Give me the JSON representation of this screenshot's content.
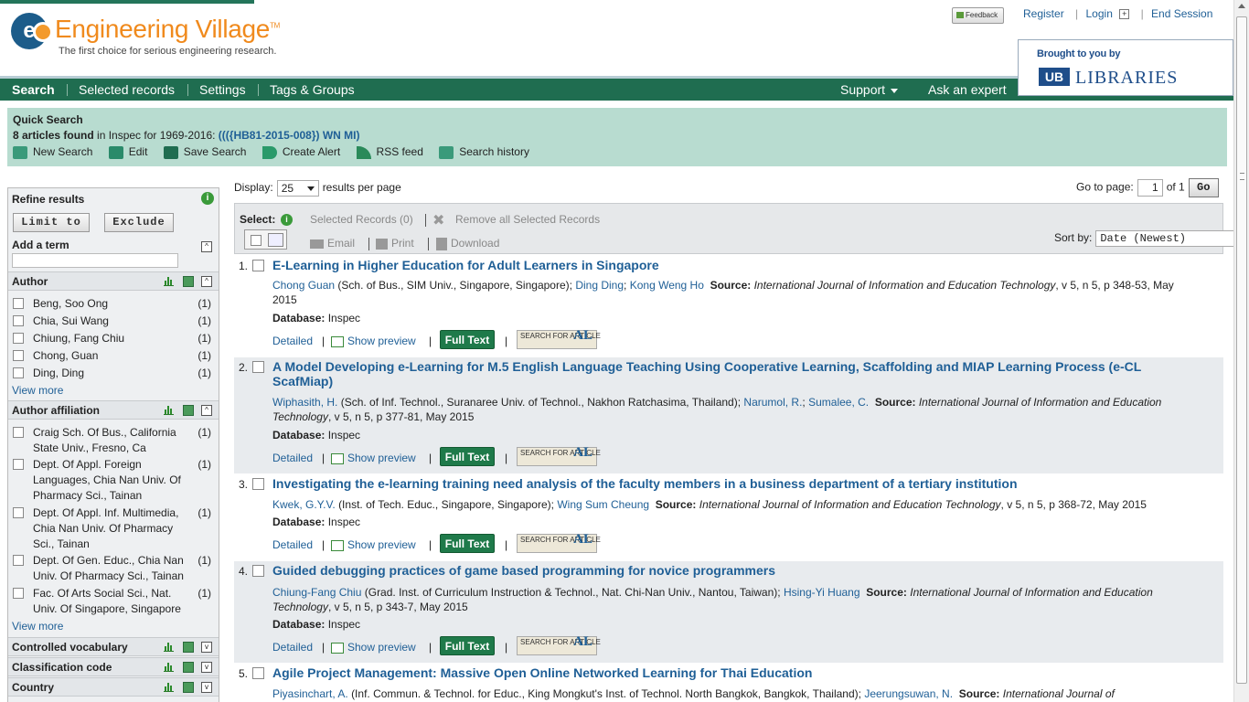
{
  "header": {
    "logo_text": "Engineering Village",
    "logo_tm": "TM",
    "tagline": "The first choice for serious engineering research.",
    "feedback_label": "Feedback",
    "links": {
      "register": "Register",
      "login": "Login",
      "end_session": "End Session"
    },
    "brought_to_you": "Brought to you by",
    "library_name": "LIBRARIES",
    "library_logo": "UB"
  },
  "nav": {
    "search": "Search",
    "selected_records": "Selected records",
    "settings": "Settings",
    "tags_groups": "Tags & Groups",
    "support": "Support",
    "ask_expert": "Ask an expert"
  },
  "quick_search": {
    "title": "Quick Search",
    "count": "8 articles found",
    "in_text": "in Inspec for 1969-2016:",
    "query": "((({HB81-2015-008}) WN MI)",
    "tools": {
      "new_search": "New Search",
      "edit": "Edit",
      "save_search": "Save Search",
      "create_alert": "Create Alert",
      "rss": "RSS feed",
      "history": "Search history"
    }
  },
  "sidebar": {
    "refine_title": "Refine results",
    "limit_to": "Limit to",
    "exclude": "Exclude",
    "add_term": "Add a term",
    "author": {
      "label": "Author",
      "items": [
        {
          "name": "Beng, Soo Ong",
          "count": "(1)"
        },
        {
          "name": "Chia, Sui Wang",
          "count": "(1)"
        },
        {
          "name": "Chiung, Fang Chiu",
          "count": "(1)"
        },
        {
          "name": "Chong, Guan",
          "count": "(1)"
        },
        {
          "name": "Ding, Ding",
          "count": "(1)"
        }
      ],
      "view_more": "View more"
    },
    "affiliation": {
      "label": "Author affiliation",
      "items": [
        {
          "name": "Craig Sch. Of Bus., California State Univ., Fresno, Ca",
          "count": "(1)"
        },
        {
          "name": "Dept. Of Appl. Foreign Languages, Chia Nan Univ. Of Pharmacy Sci., Tainan",
          "count": "(1)"
        },
        {
          "name": "Dept. Of Appl. Inf. Multimedia, Chia Nan Univ. Of Pharmacy Sci., Tainan",
          "count": "(1)"
        },
        {
          "name": "Dept. Of Gen. Educ., Chia Nan Univ. Of Pharmacy Sci., Tainan",
          "count": "(1)"
        },
        {
          "name": "Fac. Of Arts Social Sci., Nat. Univ. Of Singapore, Singapore",
          "count": "(1)"
        }
      ],
      "view_more": "View more"
    },
    "controlled_vocab": "Controlled vocabulary",
    "classification": "Classification code",
    "country": "Country"
  },
  "results": {
    "display_label": "Display:",
    "display_value": "25",
    "per_page": "results per page",
    "go_to_page": "Go to page:",
    "page_value": "1",
    "of_pages": "of 1",
    "go": "Go",
    "select_label": "Select:",
    "selected_records": "Selected Records (0)",
    "remove_all": "Remove all Selected Records",
    "email": "Email",
    "print": "Print",
    "download": "Download",
    "sort_by": "Sort by:",
    "sort_value": "Date (Newest)",
    "detailed": "Detailed",
    "show_preview": "Show preview",
    "full_text": "Full Text",
    "search_article": "SEARCH FOR ARTICLE",
    "db_label": "Database:",
    "source_label": "Source:",
    "records": [
      {
        "num": "1.",
        "title": "E-Learning in Higher Education for Adult Learners in Singapore",
        "authors": [
          {
            "name": "Chong Guan",
            "aff": "(Sch. of Bus., SIM Univ., Singapore, Singapore);"
          },
          {
            "name": "Ding Ding",
            "aff": ";"
          },
          {
            "name": "Kong Weng Ho",
            "aff": ""
          }
        ],
        "source": "International Journal of Information and Education Technology",
        "details": ", v 5, n 5, p 348-53, May 2015",
        "database": "Inspec"
      },
      {
        "num": "2.",
        "title": "A Model Developing e-Learning for M.5 English Language Teaching Using Cooperative Learning, Scaffolding and MIAP Learning Process (e-CL ScafMiap)",
        "authors": [
          {
            "name": "Wiphasith, H.",
            "aff": "(Sch. of Inf. Technol., Suranaree Univ. of Technol., Nakhon Ratchasima, Thailand);"
          },
          {
            "name": "Narumol, R.",
            "aff": ";"
          },
          {
            "name": "Sumalee, C.",
            "aff": ""
          }
        ],
        "source": "International Journal of Information and Education Technology",
        "details": ", v 5, n 5, p 377-81, May 2015",
        "database": "Inspec"
      },
      {
        "num": "3.",
        "title": "Investigating the e-learning training need analysis of the faculty members in a business department of a tertiary institution",
        "authors": [
          {
            "name": "Kwek, G.Y.V.",
            "aff": "(Inst. of Tech. Educ., Singapore, Singapore);"
          },
          {
            "name": "Wing Sum Cheung",
            "aff": ""
          }
        ],
        "source": "International Journal of Information and Education Technology",
        "details": ", v 5, n 5, p 368-72, May 2015",
        "database": "Inspec"
      },
      {
        "num": "4.",
        "title": "Guided debugging practices of game based programming for novice programmers",
        "authors": [
          {
            "name": "Chiung-Fang Chiu",
            "aff": "(Grad. Inst. of Curriculum Instruction & Technol., Nat. Chi-Nan Univ., Nantou, Taiwan);"
          },
          {
            "name": "Hsing-Yi Huang",
            "aff": ""
          }
        ],
        "source": "International Journal of Information and Education Technology",
        "details": ", v 5, n 5, p 343-7, May 2015",
        "database": "Inspec"
      },
      {
        "num": "5.",
        "title": "Agile Project Management: Massive Open Online Networked Learning for Thai Education",
        "authors": [
          {
            "name": "Piyasinchart, A.",
            "aff": "(Inf. Commun. & Technol. for Educ., King Mongkut's Inst. of Technol. North Bangkok, Bangkok, Thailand);"
          },
          {
            "name": "Jeerungsuwan, N.",
            "aff": ""
          }
        ],
        "source": "International Journal of",
        "details": "",
        "database": ""
      }
    ]
  }
}
